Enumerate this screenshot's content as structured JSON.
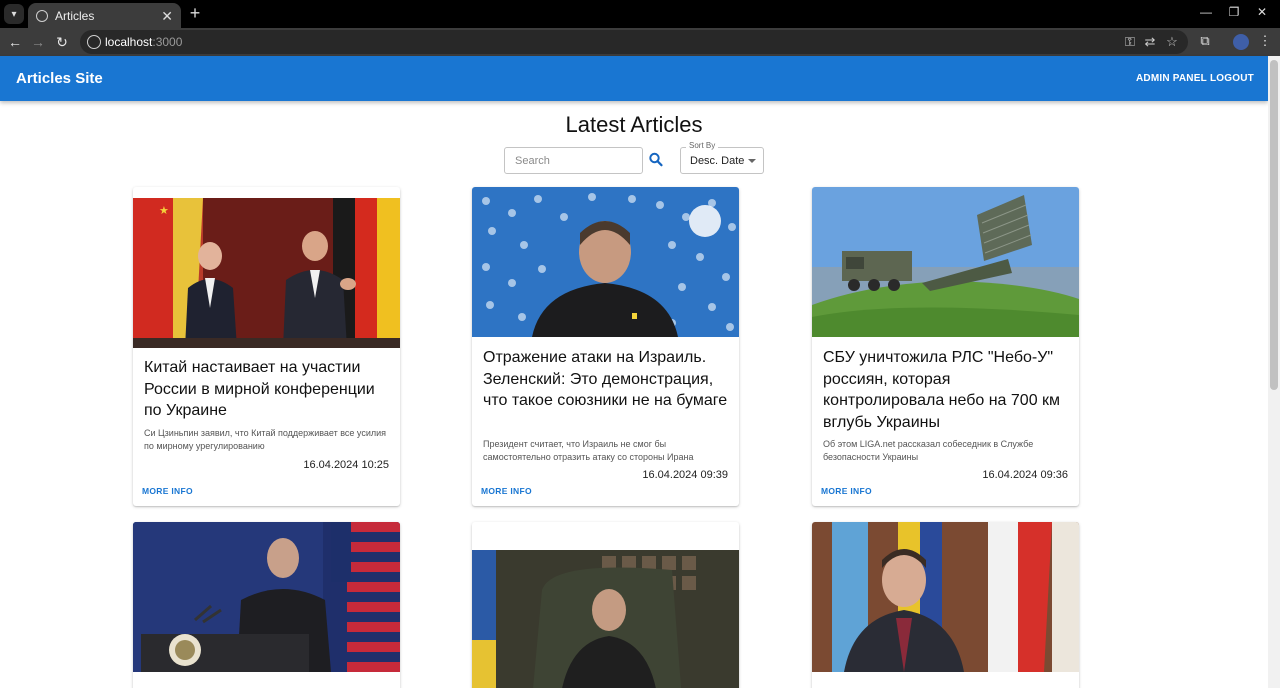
{
  "browser": {
    "tab_title": "Articles",
    "url_host": "localhost",
    "url_port": ":3000"
  },
  "appbar": {
    "brand": "Articles Site",
    "admin_label": "ADMIN PANEL",
    "logout_label": "LOGOUT"
  },
  "main": {
    "heading": "Latest Articles",
    "search_placeholder": "Search",
    "sort_label": "Sort By",
    "sort_value": "Desc. Date"
  },
  "more_label": "MORE INFO",
  "articles": [
    {
      "title": "Китай настаивает на участии России в мирной конференции по Украине",
      "desc": "Си Цзиньпин заявил, что Китай поддерживает все усилия по мирному урегулированию",
      "date": "16.04.2024 10:25"
    },
    {
      "title": "Отражение атаки на Израиль. Зеленский: Это демонстрация, что такое союзники не на бумаге",
      "desc": "Президент считает, что Израиль не смог бы самостоятельно отразить атаку со стороны Ирана",
      "date": "16.04.2024 09:39"
    },
    {
      "title": "СБУ уничтожила РЛС \"Небо-У\" россиян, которая контролировала небо на 700 км вглубь Украины",
      "desc": "Об этом LIGA.net рассказал собеседник в Службе безопасности Украины",
      "date": "16.04.2024 09:36"
    }
  ]
}
